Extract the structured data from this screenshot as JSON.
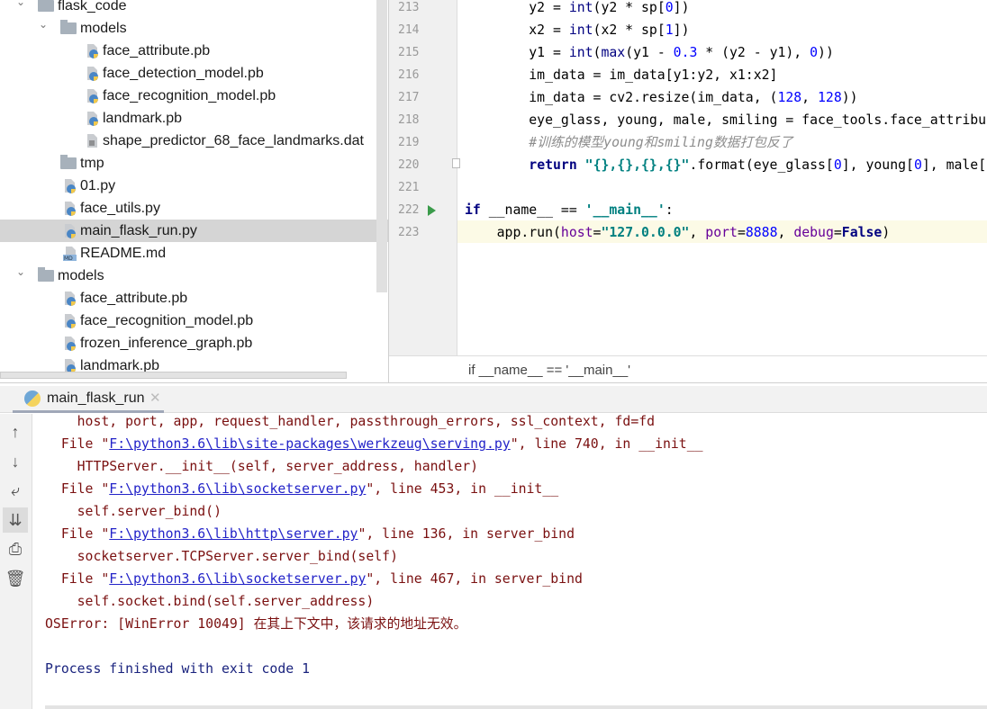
{
  "project_tree": {
    "items": [
      {
        "label": "flask_code",
        "type": "folder",
        "level": 0,
        "expanded": true
      },
      {
        "label": "models",
        "type": "folder",
        "level": 1,
        "expanded": true
      },
      {
        "label": "face_attribute.pb",
        "type": "python-file",
        "level": 2
      },
      {
        "label": "face_detection_model.pb",
        "type": "python-file",
        "level": 2
      },
      {
        "label": "face_recognition_model.pb",
        "type": "python-file",
        "level": 2
      },
      {
        "label": "landmark.pb",
        "type": "python-file",
        "level": 2
      },
      {
        "label": "shape_predictor_68_face_landmarks.dat",
        "type": "text-file",
        "level": 2
      },
      {
        "label": "tmp",
        "type": "folder",
        "level": 1,
        "expanded": false
      },
      {
        "label": "01.py",
        "type": "python-file",
        "level": 1
      },
      {
        "label": "face_utils.py",
        "type": "python-file",
        "level": 1
      },
      {
        "label": "main_flask_run.py",
        "type": "python-file",
        "level": 1,
        "selected": true
      },
      {
        "label": "README.md",
        "type": "markdown-file",
        "level": 1
      },
      {
        "label": "models",
        "type": "folder",
        "level": 0,
        "expanded": true
      },
      {
        "label": "face_attribute.pb",
        "type": "python-file",
        "level": 1
      },
      {
        "label": "face_recognition_model.pb",
        "type": "python-file",
        "level": 1
      },
      {
        "label": "frozen_inference_graph.pb",
        "type": "python-file",
        "level": 1
      },
      {
        "label": "landmark.pb",
        "type": "python-file",
        "level": 1
      }
    ]
  },
  "editor": {
    "current_line": 223,
    "lines": [
      {
        "n": "213",
        "tokens": [
          [
            "        y2 = ",
            ""
          ],
          [
            "int",
            "bi"
          ],
          [
            "(y2 * sp[",
            ""
          ],
          [
            "0",
            "num"
          ],
          [
            "])",
            ""
          ]
        ]
      },
      {
        "n": "214",
        "tokens": [
          [
            "        x2 = ",
            ""
          ],
          [
            "int",
            "bi"
          ],
          [
            "(x2 * sp[",
            ""
          ],
          [
            "1",
            "num"
          ],
          [
            "])",
            ""
          ]
        ]
      },
      {
        "n": "215",
        "tokens": [
          [
            "        y1 = ",
            ""
          ],
          [
            "int",
            "bi"
          ],
          [
            "(",
            ""
          ],
          [
            "max",
            "bi"
          ],
          [
            "(y1 - ",
            ""
          ],
          [
            "0.3",
            "num"
          ],
          [
            " * (y2 - y1), ",
            ""
          ],
          [
            "0",
            "num"
          ],
          [
            "))",
            ""
          ]
        ]
      },
      {
        "n": "216",
        "tokens": [
          [
            "        im_data = im_data[y1:y2, x1:x2]",
            ""
          ]
        ]
      },
      {
        "n": "217",
        "tokens": [
          [
            "        im_data = cv2.resize(im_data, (",
            ""
          ],
          [
            "128",
            "num"
          ],
          [
            ", ",
            ""
          ],
          [
            "128",
            "num"
          ],
          [
            "))",
            ""
          ]
        ]
      },
      {
        "n": "218",
        "tokens": [
          [
            "        eye_glass, young, male, smiling = face_tools.face_attribu",
            ""
          ]
        ]
      },
      {
        "n": "219",
        "tokens": [
          [
            "        ",
            ""
          ],
          [
            "#训练的模型young和smiling数据打包反了",
            "cmt"
          ]
        ]
      },
      {
        "n": "220",
        "tokens": [
          [
            "        ",
            ""
          ],
          [
            "return",
            "kw"
          ],
          [
            " ",
            ""
          ],
          [
            "\"{},{},{},{}\"",
            "str"
          ],
          [
            ".format(eye_glass[",
            ""
          ],
          [
            "0",
            "num"
          ],
          [
            "], young[",
            ""
          ],
          [
            "0",
            "num"
          ],
          [
            "], male[",
            ""
          ]
        ]
      },
      {
        "n": "221",
        "tokens": []
      },
      {
        "n": "222",
        "tokens": [
          [
            "if",
            "kw"
          ],
          [
            " __name__ == ",
            ""
          ],
          [
            "'__main__'",
            "str"
          ],
          [
            ":",
            ""
          ]
        ],
        "run_marker": true
      },
      {
        "n": "223",
        "tokens": [
          [
            "    app.run(",
            ""
          ],
          [
            "host",
            "kwarg"
          ],
          [
            "=",
            ""
          ],
          [
            "\"127.0.0.0\"",
            "str"
          ],
          [
            ", ",
            ""
          ],
          [
            "port",
            "kwarg"
          ],
          [
            "=",
            ""
          ],
          [
            "8888",
            "num"
          ],
          [
            ", ",
            ""
          ],
          [
            "debug",
            "kwarg"
          ],
          [
            "=",
            ""
          ],
          [
            "False",
            "kw"
          ],
          [
            ")",
            ""
          ]
        ]
      }
    ],
    "breadcrumb": "if __name__ == '__main__'"
  },
  "run_panel": {
    "tab_label": "main_flask_run",
    "tools": [
      "up-arrow-icon",
      "down-arrow-icon",
      "soft-wrap-icon",
      "scroll-to-end-icon",
      "print-icon",
      "trash-icon"
    ],
    "output": [
      [
        [
          "    host, port, app, request_handler, passthrough_errors, ssl_context, fd=fd",
          ""
        ]
      ],
      [
        [
          "  File \"",
          ""
        ],
        [
          "F:\\python3.6\\lib\\site-packages\\werkzeug\\serving.py",
          "link"
        ],
        [
          "\", line 740, in __init__",
          ""
        ]
      ],
      [
        [
          "    HTTPServer.__init__(self, server_address, handler)",
          ""
        ]
      ],
      [
        [
          "  File \"",
          ""
        ],
        [
          "F:\\python3.6\\lib\\socketserver.py",
          "link"
        ],
        [
          "\", line 453, in __init__",
          ""
        ]
      ],
      [
        [
          "    self.server_bind()",
          ""
        ]
      ],
      [
        [
          "  File \"",
          ""
        ],
        [
          "F:\\python3.6\\lib\\http\\server.py",
          "link"
        ],
        [
          "\", line 136, in server_bind",
          ""
        ]
      ],
      [
        [
          "    socketserver.TCPServer.server_bind(self)",
          ""
        ]
      ],
      [
        [
          "  File \"",
          ""
        ],
        [
          "F:\\python3.6\\lib\\socketserver.py",
          "link"
        ],
        [
          "\", line 467, in server_bind",
          ""
        ]
      ],
      [
        [
          "    self.socket.bind(self.server_address)",
          ""
        ]
      ],
      [
        [
          "OSError: [WinError 10049] 在其上下文中，该请求的地址无效。",
          ""
        ]
      ],
      [],
      [
        [
          "Process finished with exit code 1",
          "proc"
        ]
      ]
    ]
  },
  "colors": {
    "selection": "#d5d5d5",
    "current_line": "#fcfae6",
    "error_text": "#7a1010",
    "link": "#2323c8",
    "run_marker": "#3a9b4a"
  }
}
